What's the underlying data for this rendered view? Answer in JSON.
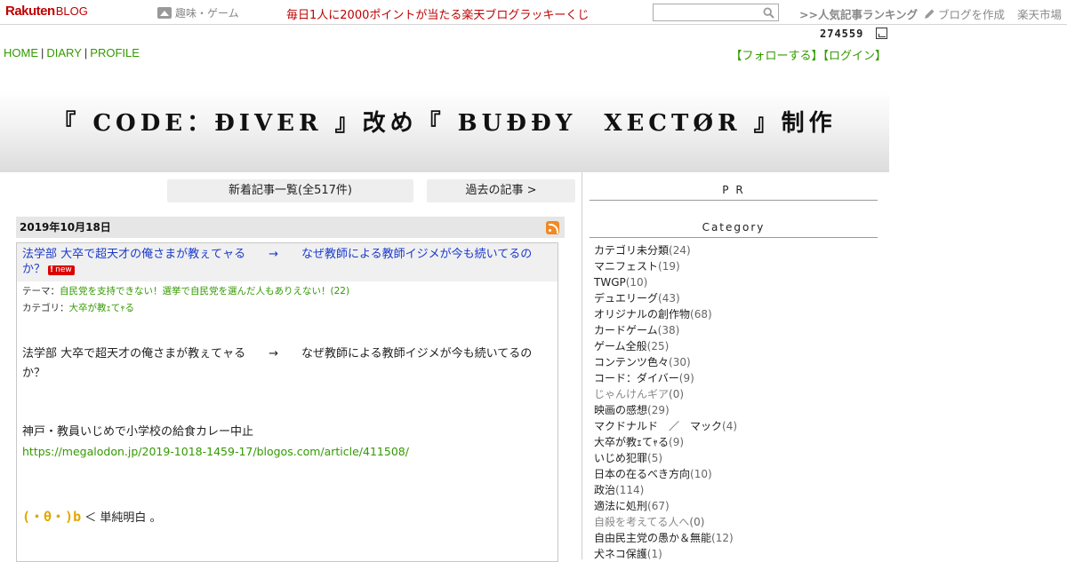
{
  "topbar": {
    "logo_main": "Rakuten",
    "logo_sub": "BLOG",
    "genre": "趣味・ゲーム",
    "lottery": "毎日1人に2000ポイントが当たる楽天ブログラッキーくじ",
    "search_value": "",
    "ranking": ">>人気記事ランキング",
    "create_blog": "ブログを作成",
    "market": "楽天市場"
  },
  "counter": "274559",
  "nav": {
    "home": "HOME",
    "diary": "DIARY",
    "profile": "PROFILE",
    "sep": "|",
    "follow": "【フォローする】",
    "login": "【ログイン】"
  },
  "header": {
    "title": "『 CODE：ĐIVER 』改め『 BUĐĐY　XECTØR 』制作"
  },
  "main": {
    "new_articles_button": "新着記事一覧(全517件)",
    "past_articles_button": "過去の記事 >",
    "date": "2019年10月18日",
    "article": {
      "title": "法学部 大卒で超天才の俺さまが教ぇてャる　　→　　なぜ教師による教師イジメが今も続いてるのか？",
      "new_badge": "new",
      "theme_label": "テーマ：",
      "theme": "自民党を支持できない！選挙で自民党を選んだ人もありえない！(22)",
      "category_label": "カテゴリ：",
      "category": "大卒が教ｪてｬる",
      "body_line1": "法学部 大卒で超天才の俺さまが教ぇてャる　　→　　なぜ教師による教師イジメが今も続いてるのか？",
      "body_line2": "神戸・教員いじめで小学校の給食カレー中止",
      "body_link": "https://megalodon.jp/2019-1018-1459-17/blogos.com/article/411508/",
      "emote_face": "(・θ・)b",
      "emote_text": " ＜ 単純明白 。"
    }
  },
  "sidebar": {
    "pr_heading": "P R",
    "category_heading": "Category",
    "categories": [
      {
        "name": "カテゴリ未分類",
        "count": "(24)"
      },
      {
        "name": "マニフェスト",
        "count": "(19)"
      },
      {
        "name": "TWGP",
        "count": "(10)"
      },
      {
        "name": "デュエリーグ",
        "count": "(43)"
      },
      {
        "name": "オリジナルの創作物",
        "count": "(68)"
      },
      {
        "name": "カードゲーム",
        "count": "(38)"
      },
      {
        "name": "ゲーム全般",
        "count": "(25)"
      },
      {
        "name": "コンテンツ色々",
        "count": "(30)"
      },
      {
        "name": "コード：ダイバー",
        "count": "(9)"
      },
      {
        "name": "じゃんけんギア",
        "count": "(0)"
      },
      {
        "name": "映画の感想",
        "count": "(29)"
      },
      {
        "name": "マクドナルド　／　マック",
        "count": "(4)"
      },
      {
        "name": "大卒が教ｪてｬる",
        "count": "(9)"
      },
      {
        "name": "いじめ犯罪",
        "count": "(5)"
      },
      {
        "name": "日本の在るべき方向",
        "count": "(10)"
      },
      {
        "name": "政治",
        "count": "(114)"
      },
      {
        "name": "適法に処刑",
        "count": "(67)"
      },
      {
        "name": "自殺を考えてる人へ",
        "count": "(0)"
      },
      {
        "name": "自由民主党の愚か＆無能",
        "count": "(12)"
      },
      {
        "name": "犬ネコ保護",
        "count": "(1)"
      }
    ]
  }
}
